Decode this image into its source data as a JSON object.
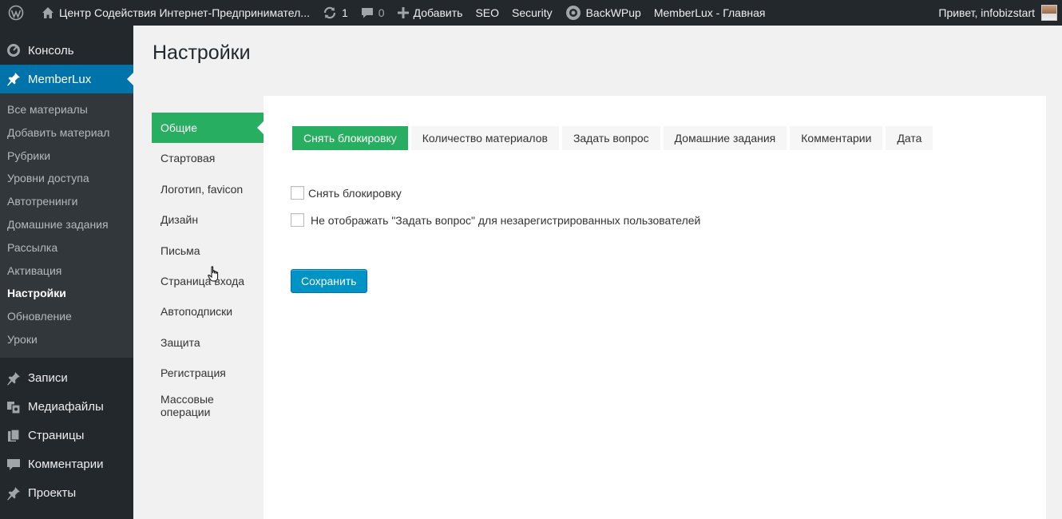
{
  "adminbar": {
    "site_name": "Центр Содействия Интернет-Предпринимател...",
    "updates_count": "1",
    "comments_count": "0",
    "add_new_label": "Добавить",
    "seo_label": "SEO",
    "security_label": "Security",
    "backwpup_label": "BackWPup",
    "memberlux_home_label": "MemberLux - Главная",
    "greeting": "Привет, infobizstart"
  },
  "sidebar": {
    "dashboard_label": "Консоль",
    "memberlux_label": "MemberLux",
    "submenu": [
      "Все материалы",
      "Добавить материал",
      "Рубрики",
      "Уровни доступа",
      "Автотренинги",
      "Домашние задания",
      "Рассылка",
      "Активация",
      "Настройки",
      "Обновление",
      "Уроки"
    ],
    "posts_label": "Записи",
    "media_label": "Медиафайлы",
    "pages_label": "Страницы",
    "comments_label": "Комментарии",
    "projects_label": "Проекты"
  },
  "page": {
    "title": "Настройки"
  },
  "settings_nav": [
    "Общие",
    "Стартовая",
    "Логотип, favicon",
    "Дизайн",
    "Письма",
    "Страница входа",
    "Автоподписки",
    "Защита",
    "Регистрация",
    "Массовые операции"
  ],
  "tabs": [
    "Снять блокировку",
    "Количество материалов",
    "Задать вопрос",
    "Домашние задания",
    "Комментарии",
    "Дата"
  ],
  "options": {
    "unblock_label": "Снять блокировку",
    "hide_ask_label": "Не отображать \"Задать вопрос\" для незарегистрированных пользователей"
  },
  "save_label": "Сохранить",
  "colors": {
    "admin_dark": "#23282d",
    "submenu_bg": "#32373c",
    "current_blue": "#0073aa",
    "active_green": "#27ae60",
    "save_blue": "#0093c6"
  }
}
